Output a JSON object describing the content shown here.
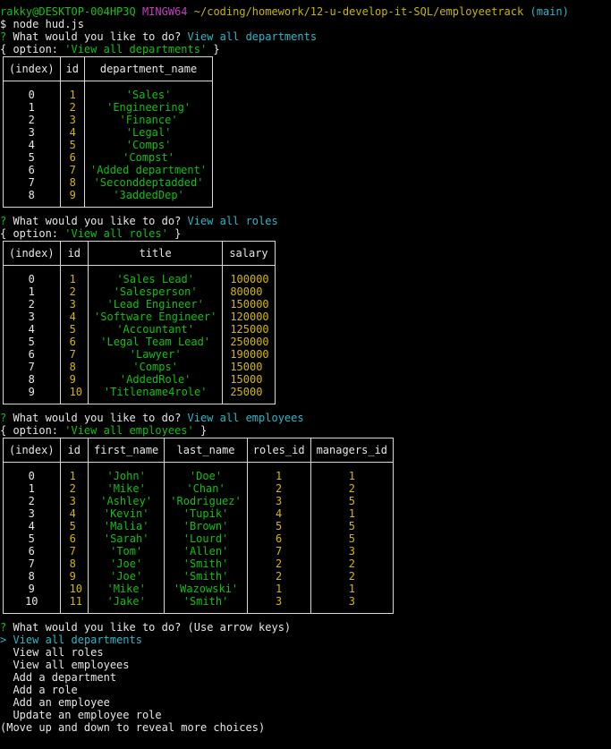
{
  "prompt": {
    "user": "rakky@DESKTOP-004HP3Q",
    "shell": "MINGW64",
    "path": "~/coding/homework/12-u-develop-it-SQL/employeetrack",
    "branch": "(main)",
    "symbol": "$",
    "command": "node hud.js"
  },
  "question": {
    "mark": "?",
    "text": "What would you like to do?",
    "option_prefix": "{ option: ",
    "option_suffix": " }"
  },
  "blocks": [
    {
      "answer": "View all departments",
      "option_value": "'View all departments'",
      "columns": [
        "(index)",
        "id",
        "department_name"
      ],
      "rows": [
        [
          "0",
          "1",
          "'Sales'"
        ],
        [
          "1",
          "2",
          "'Engineering'"
        ],
        [
          "2",
          "3",
          "'Finance'"
        ],
        [
          "3",
          "4",
          "'Legal'"
        ],
        [
          "4",
          "5",
          "'Comps'"
        ],
        [
          "5",
          "6",
          "'Compst'"
        ],
        [
          "6",
          "7",
          "'Added department'"
        ],
        [
          "7",
          "8",
          "'Seconddeptadded'"
        ],
        [
          "8",
          "9",
          "'3addedDep'"
        ]
      ]
    },
    {
      "answer": "View all roles",
      "option_value": "'View all roles'",
      "columns": [
        "(index)",
        "id",
        "title",
        "salary"
      ],
      "rows": [
        [
          "0",
          "1",
          "'Sales Lead'",
          "100000"
        ],
        [
          "1",
          "2",
          "'Salesperson'",
          "80000"
        ],
        [
          "2",
          "3",
          "'Lead Engineer'",
          "150000"
        ],
        [
          "3",
          "4",
          "'Software Engineer'",
          "120000"
        ],
        [
          "4",
          "5",
          "'Accountant'",
          "125000"
        ],
        [
          "5",
          "6",
          "'Legal Team Lead'",
          "250000"
        ],
        [
          "6",
          "7",
          "'Lawyer'",
          "190000"
        ],
        [
          "7",
          "8",
          "'Comps'",
          "15000"
        ],
        [
          "8",
          "9",
          "'AddedRole'",
          "15000"
        ],
        [
          "9",
          "10",
          "'Titlename4role'",
          "25000"
        ]
      ]
    },
    {
      "answer": "View all employees",
      "option_value": "'View all employees'",
      "columns": [
        "(index)",
        "id",
        "first_name",
        "last_name",
        "roles_id",
        "managers_id"
      ],
      "rows": [
        [
          "0",
          "1",
          "'John'",
          "'Doe'",
          "1",
          "1"
        ],
        [
          "1",
          "2",
          "'Mike'",
          "'Chan'",
          "2",
          "2"
        ],
        [
          "2",
          "3",
          "'Ashley'",
          "'Rodriguez'",
          "3",
          "5"
        ],
        [
          "3",
          "4",
          "'Kevin'",
          "'Tupik'",
          "4",
          "1"
        ],
        [
          "4",
          "5",
          "'Malia'",
          "'Brown'",
          "5",
          "5"
        ],
        [
          "5",
          "6",
          "'Sarah'",
          "'Lourd'",
          "6",
          "5"
        ],
        [
          "6",
          "7",
          "'Tom'",
          "'Allen'",
          "7",
          "3"
        ],
        [
          "7",
          "8",
          "'Joe'",
          "'Smith'",
          "2",
          "2"
        ],
        [
          "8",
          "9",
          "'Joe'",
          "'Smith'",
          "2",
          "2"
        ],
        [
          "9",
          "10",
          "'Mike'",
          "'Wazowski'",
          "1",
          "1"
        ],
        [
          "10",
          "11",
          "'Jake'",
          "'Smith'",
          "3",
          "3"
        ]
      ]
    }
  ],
  "menu": {
    "hint": "(Use arrow keys)",
    "pointer": ">",
    "items": [
      "View all departments",
      "View all roles",
      "View all employees",
      "Add a department",
      "Add a role",
      "Add an employee",
      "Update an employee role"
    ],
    "footer": "(Move up and down to reveal more choices)"
  },
  "colors": {
    "background": "#000000",
    "prompt_user": "#18c018",
    "prompt_shell": "#c040c0",
    "prompt_path": "#c8b400",
    "answer": "#2ab8c8",
    "string_value": "#10c010",
    "number_value": "#d4b800"
  }
}
